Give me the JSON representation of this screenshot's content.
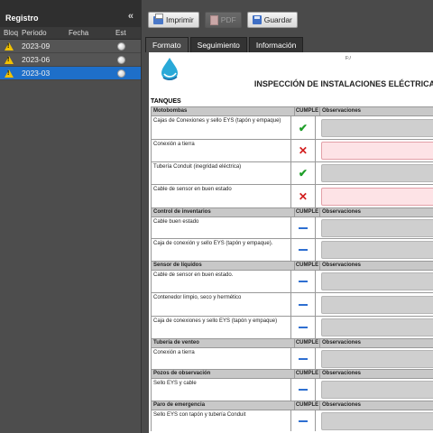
{
  "left_panel": {
    "title": "Registro",
    "collapse_glyph": "«",
    "columns": [
      "Bloq",
      "Periodo",
      "Fecha",
      "Esta"
    ],
    "rows": [
      {
        "periodo": "2023-09",
        "fecha": "",
        "selected": false
      },
      {
        "periodo": "2023-06",
        "fecha": "",
        "selected": false
      },
      {
        "periodo": "2023-03",
        "fecha": "",
        "selected": true
      }
    ]
  },
  "toolbar": {
    "print_label": "Imprimir",
    "pdf_label": "PDF",
    "save_label": "Guardar"
  },
  "tabs": [
    "Formato",
    "Seguimiento",
    "Información"
  ],
  "document": {
    "folio": "F:/",
    "title": "INSPECCIÓN DE INSTALACIONES ELÉCTRICAS",
    "section": "TANQUES",
    "col_cumple": "CUMPLE",
    "col_obs": "Observaciones",
    "groups": [
      {
        "name": "Motobombas",
        "items": [
          {
            "text": "Cajas de Conexiones y sello EYS (tapón y empaque)",
            "status": "ok"
          },
          {
            "text": "Conexión a tierra",
            "status": "no"
          },
          {
            "text": "Tubería Conduit (inegridad eléctrica)",
            "status": "ok"
          },
          {
            "text": "Cable de sensor en buen estado",
            "status": "no"
          }
        ]
      },
      {
        "name": "Control de inventarios",
        "items": [
          {
            "text": "Cable buen estado",
            "status": "pend"
          },
          {
            "text": "Caja de conexión y sello EYS (tapón y empaque).",
            "status": "pend"
          }
        ]
      },
      {
        "name": "Sensor de líquidos",
        "items": [
          {
            "text": "Cable de sensor en buen estado.",
            "status": "pend"
          },
          {
            "text": "Contenedor limpio, seco y hermético",
            "status": "pend"
          },
          {
            "text": "Caja de conexiones y sello EYS (tapón y empaque)",
            "status": "pend"
          }
        ]
      },
      {
        "name": "Tubería de venteo",
        "items": [
          {
            "text": "Conexión a tierra",
            "status": "pend"
          }
        ]
      },
      {
        "name": "Pozos de observación",
        "items": [
          {
            "text": "Sello EYS y cable",
            "status": "pend"
          }
        ]
      },
      {
        "name": "Paro de emergencia",
        "items": [
          {
            "text": "Sello EYS con tapón y tubería Conduit",
            "status": "pend"
          }
        ]
      }
    ]
  },
  "colors": {
    "selected_row": "#1e6fc9",
    "check": "#1e9e28",
    "cross": "#d21c1c",
    "pending": "#2e6fd1"
  }
}
